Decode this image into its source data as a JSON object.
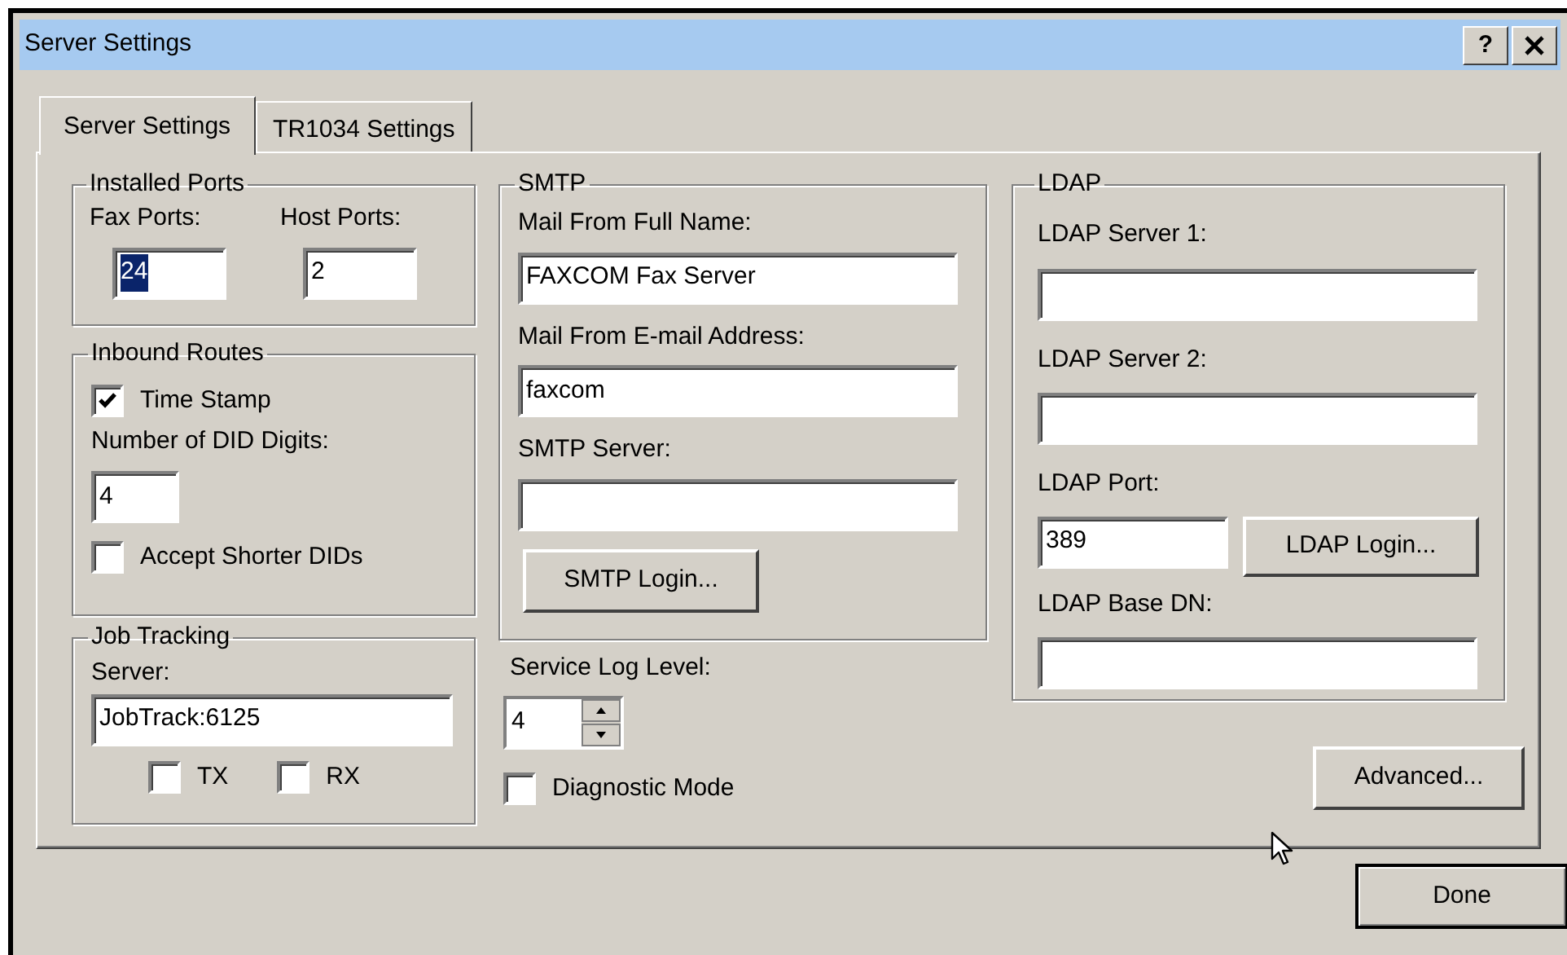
{
  "window": {
    "title": "Server Settings",
    "help_label": "?"
  },
  "tabs": [
    {
      "label": "Server Settings",
      "selected": true
    },
    {
      "label": "TR1034 Settings",
      "selected": false
    }
  ],
  "installed_ports": {
    "title": "Installed Ports",
    "fields": [
      {
        "label": "Fax Ports:",
        "value": "24",
        "text_selected": true
      },
      {
        "label": "Host Ports:",
        "value": "2",
        "text_selected": false
      }
    ]
  },
  "inbound_routes": {
    "title": "Inbound Routes",
    "items": [
      {
        "kind": "checkbox",
        "label": "Time Stamp",
        "checked": true
      },
      {
        "kind": "field",
        "label": "Number of DID Digits:",
        "value": "4"
      },
      {
        "kind": "checkbox",
        "label": "Accept Shorter DIDs",
        "checked": false
      }
    ]
  },
  "job_tracking": {
    "title": "Job Tracking",
    "server_label": "Server:",
    "server_value": "JobTrack:6125",
    "checkboxes": [
      {
        "label": "TX",
        "checked": false
      },
      {
        "label": "RX",
        "checked": false
      }
    ]
  },
  "smtp": {
    "title": "SMTP",
    "fields": [
      {
        "label": "Mail From Full Name:",
        "value": "FAXCOM Fax Server"
      },
      {
        "label": "Mail From E-mail Address:",
        "value": "faxcom"
      },
      {
        "label": "SMTP Server:"
      }
    ],
    "login_button": "SMTP Login..."
  },
  "service_log": {
    "label": "Service Log Level:",
    "value": "4"
  },
  "diagnostic_mode": {
    "label": "Diagnostic Mode",
    "checked": false
  },
  "ldap": {
    "title": "LDAP",
    "items": [
      {
        "kind": "field",
        "label": "LDAP Server 1:"
      },
      {
        "kind": "field",
        "label": "LDAP Server 2:"
      },
      {
        "kind": "port",
        "label": "LDAP Port:",
        "value": "389",
        "button": "LDAP Login..."
      },
      {
        "kind": "field",
        "label": "LDAP Base DN:"
      }
    ]
  },
  "advanced_button": "Advanced...",
  "done_button": "Done"
}
